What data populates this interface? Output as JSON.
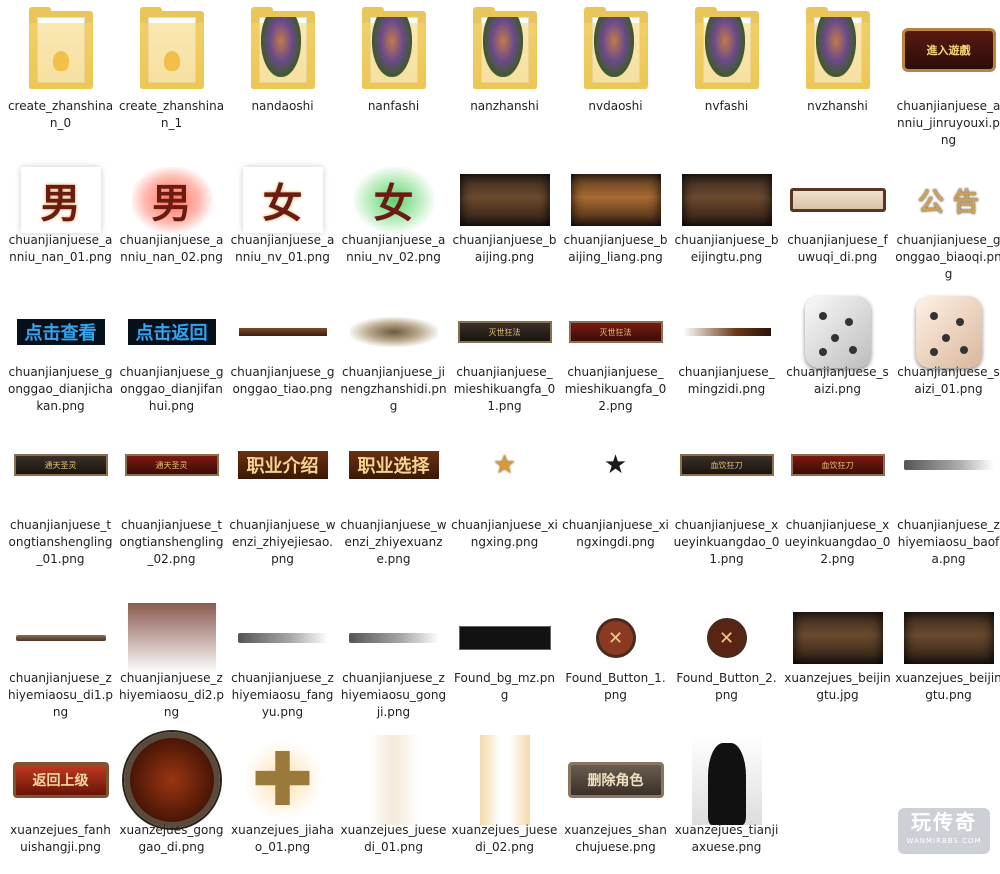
{
  "window": {
    "title": ""
  },
  "files": [
    {
      "name": "create_zhanshinan_0",
      "kind": "folder",
      "thumb": "folder-blank-icon"
    },
    {
      "name": "create_zhanshinan_1",
      "kind": "folder",
      "thumb": "folder-blank-icon"
    },
    {
      "name": "nandaoshi",
      "kind": "folder",
      "thumb": "folder-character-icon"
    },
    {
      "name": "nanfashi",
      "kind": "folder",
      "thumb": "folder-character-icon"
    },
    {
      "name": "nanzhanshi",
      "kind": "folder",
      "thumb": "folder-character-icon"
    },
    {
      "name": "nvdaoshi",
      "kind": "folder",
      "thumb": "folder-character-icon"
    },
    {
      "name": "nvfashi",
      "kind": "folder",
      "thumb": "folder-character-icon"
    },
    {
      "name": "nvzhanshi",
      "kind": "folder",
      "thumb": "folder-character-icon"
    },
    {
      "name": "chuanjianjuese_anniu_jinruyouxi.png",
      "kind": "png",
      "thumb": "enter-game-button-image",
      "text": "進入遊戲"
    },
    {
      "name": "chuanjianjuese_anniu_nan_01.png",
      "kind": "png",
      "thumb": "male-glyph-image",
      "text": "男"
    },
    {
      "name": "chuanjianjuese_anniu_nan_02.png",
      "kind": "png",
      "thumb": "male-glyph-glow-image",
      "text": "男"
    },
    {
      "name": "chuanjianjuese_anniu_nv_01.png",
      "kind": "png",
      "thumb": "female-glyph-image",
      "text": "女"
    },
    {
      "name": "chuanjianjuese_anniu_nv_02.png",
      "kind": "png",
      "thumb": "female-glyph-glow-image",
      "text": "女"
    },
    {
      "name": "chuanjianjuese_baijing.png",
      "kind": "png",
      "thumb": "background-scene-image"
    },
    {
      "name": "chuanjianjuese_baijing_liang.png",
      "kind": "png",
      "thumb": "background-scene-light-image"
    },
    {
      "name": "chuanjianjuese_beijingtu.png",
      "kind": "png",
      "thumb": "background-scene-image"
    },
    {
      "name": "chuanjianjuese_fuwuqi_di.png",
      "kind": "png",
      "thumb": "scroll-bar-image"
    },
    {
      "name": "chuanjianjuese_gonggao_biaoqi.png",
      "kind": "png",
      "thumb": "notice-title-image",
      "text": "公 告"
    },
    {
      "name": "chuanjianjuese_gonggao_dianjichakan.png",
      "kind": "png",
      "thumb": "blue-text-button-image",
      "text": "点击查看"
    },
    {
      "name": "chuanjianjuese_gonggao_dianjifanhui.png",
      "kind": "png",
      "thumb": "blue-text-button-image",
      "text": "点击返回"
    },
    {
      "name": "chuanjianjuese_gonggao_tiao.png",
      "kind": "png",
      "thumb": "brown-bar-image"
    },
    {
      "name": "chuanjianjuese_jinengzhanshidi.png",
      "kind": "png",
      "thumb": "skill-base-image"
    },
    {
      "name": "chuanjianjuese_mieshikuangfa_01.png",
      "kind": "png",
      "thumb": "ornate-banner-image",
      "text": "灭世狂法"
    },
    {
      "name": "chuanjianjuese_mieshikuangfa_02.png",
      "kind": "png",
      "thumb": "ornate-banner-red-image",
      "text": "灭世狂法"
    },
    {
      "name": "chuanjianjuese_mingzidi.png",
      "kind": "png",
      "thumb": "name-bar-image"
    },
    {
      "name": "chuanjianjuese_saizi.png",
      "kind": "png",
      "thumb": "dice-image"
    },
    {
      "name": "chuanjianjuese_saizi_01.png",
      "kind": "png",
      "thumb": "dice-light-image"
    },
    {
      "name": "chuanjianjuese_tongtianshengling_01.png",
      "kind": "png",
      "thumb": "ornate-banner-image",
      "text": "通天圣灵"
    },
    {
      "name": "chuanjianjuese_tongtianshengling_02.png",
      "kind": "png",
      "thumb": "ornate-banner-red-image",
      "text": "通天圣灵"
    },
    {
      "name": "chuanjianjuese_wenzi_zhiyejiesao.png",
      "kind": "png",
      "thumb": "gold-text-image",
      "text": "职业介绍"
    },
    {
      "name": "chuanjianjuese_wenzi_zhiyexuanze.png",
      "kind": "png",
      "thumb": "gold-text-image",
      "text": "职业选择"
    },
    {
      "name": "chuanjianjuese_xingxing.png",
      "kind": "png",
      "thumb": "star-gold-icon"
    },
    {
      "name": "chuanjianjuese_xingxingdi.png",
      "kind": "png",
      "thumb": "star-dark-icon"
    },
    {
      "name": "chuanjianjuese_xueyinkuangdao_01.png",
      "kind": "png",
      "thumb": "ornate-banner-image",
      "text": "血饮狂刀"
    },
    {
      "name": "chuanjianjuese_xueyinkuangdao_02.png",
      "kind": "png",
      "thumb": "ornate-banner-red-image",
      "text": "血饮狂刀"
    },
    {
      "name": "chuanjianjuese_zhiyemiaosu_baofa.png",
      "kind": "png",
      "thumb": "gray-stroke-image"
    },
    {
      "name": "chuanjianjuese_zhiyemiaosu_di1.png",
      "kind": "png",
      "thumb": "thin-scroll-image"
    },
    {
      "name": "chuanjianjuese_zhiyemiaosu_di2.png",
      "kind": "png",
      "thumb": "gradient-panel-image"
    },
    {
      "name": "chuanjianjuese_zhiyemiaosu_fangyu.png",
      "kind": "png",
      "thumb": "gray-stroke-image"
    },
    {
      "name": "chuanjianjuese_zhiyemiaosu_gongji.png",
      "kind": "png",
      "thumb": "gray-stroke-image"
    },
    {
      "name": "Found_bg_mz.png",
      "kind": "png",
      "thumb": "dark-bar-image"
    },
    {
      "name": "Found_Button_1.png",
      "kind": "png",
      "thumb": "close-button-icon"
    },
    {
      "name": "Found_Button_2.png",
      "kind": "png",
      "thumb": "close-button-dark-icon"
    },
    {
      "name": "xuanzejues_beijingtu.jpg",
      "kind": "jpg",
      "thumb": "background-scene-image"
    },
    {
      "name": "xuanzejues_beijingtu.png",
      "kind": "png",
      "thumb": "background-scene-image"
    },
    {
      "name": "xuanzejues_fanhuishangji.png",
      "kind": "png",
      "thumb": "red-button-image",
      "text": "返回上级"
    },
    {
      "name": "xuanzejues_gonggao_di.png",
      "kind": "png",
      "thumb": "round-frame-image"
    },
    {
      "name": "xuanzejues_jiahao_01.png",
      "kind": "png",
      "thumb": "plus-icon"
    },
    {
      "name": "xuanzejues_juesedi_01.png",
      "kind": "png",
      "thumb": "soft-panel-image"
    },
    {
      "name": "xuanzejues_juesedi_02.png",
      "kind": "png",
      "thumb": "soft-panel-gold-image"
    },
    {
      "name": "xuanzejues_shanchujuese.png",
      "kind": "png",
      "thumb": "gray-button-image",
      "text": "删除角色"
    },
    {
      "name": "xuanzejues_tianjiaxuese.png",
      "kind": "png",
      "thumb": "silhouette-image"
    }
  ],
  "watermark": {
    "title": "玩传奇",
    "subtitle": "WANMIRBBS.COM"
  }
}
